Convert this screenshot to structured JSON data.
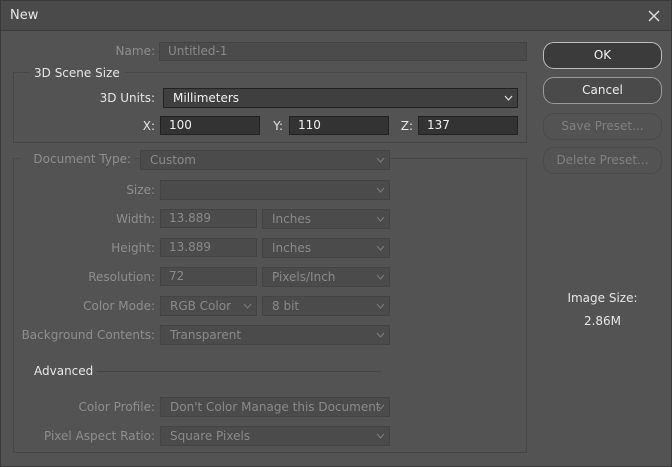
{
  "window": {
    "title": "New"
  },
  "name_field": {
    "label": "Name:",
    "value": "Untitled-1"
  },
  "scene": {
    "group_title": "3D Scene Size",
    "units_label": "3D Units:",
    "units_value": "Millimeters",
    "x_label": "X:",
    "x_value": "100",
    "y_label": "Y:",
    "y_value": "110",
    "z_label": "Z:",
    "z_value": "137"
  },
  "document": {
    "type_label": "Document Type:",
    "type_value": "Custom",
    "size_label": "Size:",
    "size_value": "",
    "width_label": "Width:",
    "width_value": "13.889",
    "width_unit": "Inches",
    "height_label": "Height:",
    "height_value": "13.889",
    "height_unit": "Inches",
    "resolution_label": "Resolution:",
    "resolution_value": "72",
    "resolution_unit": "Pixels/Inch",
    "color_mode_label": "Color Mode:",
    "color_mode_value": "RGB Color",
    "bit_depth": "8 bit",
    "background_label": "Background Contents:",
    "background_value": "Transparent"
  },
  "advanced": {
    "title": "Advanced",
    "color_profile_label": "Color Profile:",
    "color_profile_value": "Don't Color Manage this Document",
    "pixel_aspect_label": "Pixel Aspect Ratio:",
    "pixel_aspect_value": "Square Pixels"
  },
  "buttons": {
    "ok": "OK",
    "cancel": "Cancel",
    "save_preset": "Save Preset...",
    "delete_preset": "Delete Preset..."
  },
  "image_size": {
    "label": "Image Size:",
    "value": "2.86M"
  },
  "colors": {
    "background": "#535353",
    "field_active": "#333333",
    "text": "#d6d6d6",
    "text_disabled": "#8a8a8a"
  }
}
